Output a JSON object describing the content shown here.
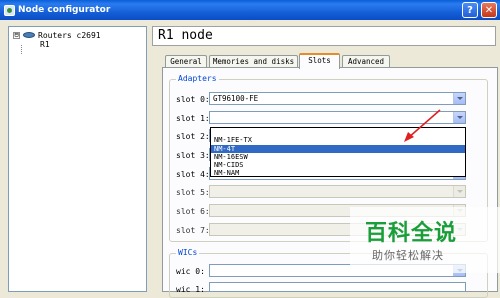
{
  "window": {
    "title": "Node configurator",
    "help_label": "?",
    "close_label": "✕"
  },
  "tree": {
    "root": "Routers c2691",
    "toggle": "⊟",
    "child": "R1"
  },
  "page_title": "R1 node",
  "tabs": [
    {
      "label": "General"
    },
    {
      "label": "Memories and disks"
    },
    {
      "label": "Slots"
    },
    {
      "label": "Advanced"
    }
  ],
  "adapters": {
    "legend": "Adapters",
    "slots": [
      {
        "label": "slot 0:",
        "value": "GT96100-FE"
      },
      {
        "label": "slot 1:",
        "value": ""
      },
      {
        "label": "slot 2:",
        "value": ""
      },
      {
        "label": "slot 3:",
        "value": ""
      },
      {
        "label": "slot 4:",
        "value": ""
      },
      {
        "label": "slot 5:",
        "value": ""
      },
      {
        "label": "slot 6:",
        "value": ""
      },
      {
        "label": "slot 7:",
        "value": ""
      }
    ]
  },
  "dropdown": {
    "options": [
      "",
      "NM-1FE-TX",
      "NM-4T",
      "NM-16ESW",
      "NM-CIDS",
      "NM-NAM"
    ],
    "selected": "NM-4T"
  },
  "wics": {
    "legend": "WICs",
    "slots": [
      {
        "label": "wic 0:",
        "value": ""
      },
      {
        "label": "wic 1:",
        "value": ""
      }
    ]
  },
  "watermark": {
    "title": "百科全说",
    "subtitle": "助你轻松解决"
  },
  "colors": {
    "selection": "#316ac5",
    "legend": "#0046d5",
    "annotation_arrow": "#e02020",
    "active_tab_accent": "#e68b2c"
  }
}
